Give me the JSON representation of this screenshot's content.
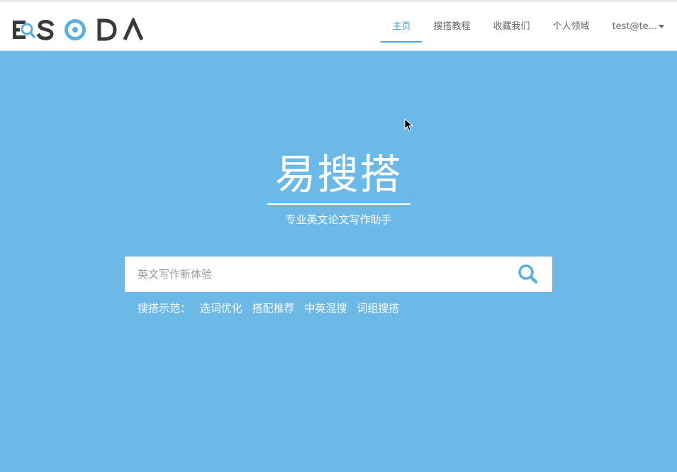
{
  "app": {
    "logo_text": "ESODA",
    "logo_icon": "magnifier-logo-icon"
  },
  "nav": {
    "items": [
      {
        "label": "主页",
        "active": true
      },
      {
        "label": "搜搭教程",
        "active": false
      },
      {
        "label": "收藏我们",
        "active": false
      },
      {
        "label": "个人领域",
        "active": false
      }
    ],
    "user": {
      "label": "test@te...",
      "icon": "chevron-down-icon"
    }
  },
  "hero": {
    "title": "易搜搭",
    "subtitle": "专业英文论文写作助手"
  },
  "search": {
    "placeholder": "英文写作新体验",
    "value": "",
    "icon": "search-icon"
  },
  "examples": {
    "label": "搜搭示范：",
    "items": [
      "选词优化",
      "搭配推荐",
      "中英混搜",
      "词组搜搭"
    ]
  },
  "colors": {
    "background": "#6cb8e6",
    "accent": "#49a2dc",
    "logo_dark": "#3a3a3a",
    "logo_blue": "#5aaee0"
  }
}
